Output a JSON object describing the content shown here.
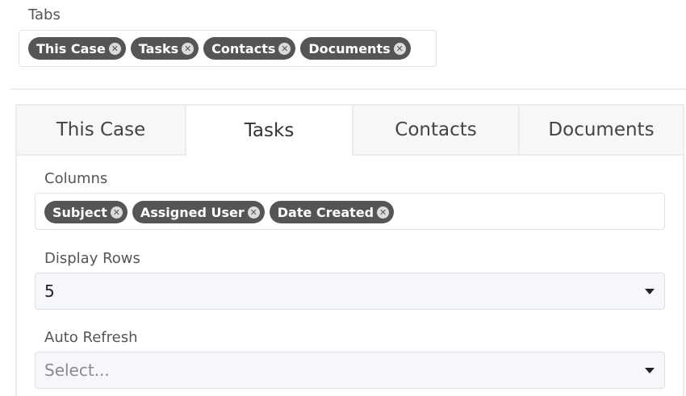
{
  "tabs_field": {
    "label": "Tabs",
    "tags": [
      "This Case",
      "Tasks",
      "Contacts",
      "Documents"
    ]
  },
  "tab_bar": {
    "tabs": [
      "This Case",
      "Tasks",
      "Contacts",
      "Documents"
    ],
    "active": "Tasks"
  },
  "columns_field": {
    "label": "Columns",
    "tags": [
      "Subject",
      "Assigned User",
      "Date Created"
    ]
  },
  "display_rows": {
    "label": "Display Rows",
    "value": "5"
  },
  "auto_refresh": {
    "label": "Auto Refresh",
    "placeholder": "Select..."
  },
  "icons": {
    "tag_remove": "close-circle-icon",
    "dropdown": "caret-down-icon"
  },
  "colors": {
    "tag_bg": "#555555",
    "select_bg": "#f5f7fa"
  }
}
